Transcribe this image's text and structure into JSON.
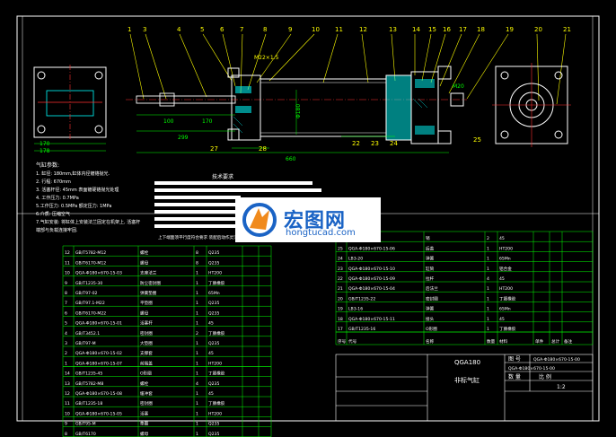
{
  "balloons": [
    "1",
    "3",
    "4",
    "5",
    "6",
    "7",
    "8",
    "9",
    "10",
    "11",
    "12",
    "13",
    "14",
    "15",
    "16",
    "17",
    "18",
    "19",
    "20",
    "21"
  ],
  "dims": {
    "d_m22": "M22×1.5",
    "d_100": "100",
    "d_170": "170",
    "d_299": "299",
    "d_660": "660",
    "d_27": "27",
    "d_28": "28",
    "d_22": "22",
    "d_23": "23",
    "d_24": "24",
    "d_25": "25",
    "d_26": "26",
    "d_m20": "M20",
    "d_180": "Φ180",
    "d_left1": "170",
    "d_left2": "178"
  },
  "notes": {
    "title": "气缸参数:",
    "lines": [
      "1. 缸径: 180mm,缸体内径镀铬抛光.",
      "2. 行程: 670mm",
      "3. 活塞杆径: 45mm  表面镀硬铬抛光处理",
      "4. 工作压力: 0.7MPa",
      "5.工作压力: 0.5MPa  额定压力: 1MPa",
      "6.介质: 压缩空气",
      "7.气缸安装: 将缸体上安装法兰固定在机架上, 活塞杆",
      "端部与负载连接牢固."
    ]
  },
  "tech": {
    "title": "技术要求",
    "bottom": "上下端面须平行度符合要求 装配后动作灵活,无卡滞和泄漏现象."
  },
  "watermark": {
    "cn": "宏图网",
    "url": "hongtucad.com"
  },
  "left_table": [
    [
      "12",
      "GB/T5782-M12",
      "螺栓",
      "8",
      "Q235",
      "",
      ""
    ],
    [
      "11",
      "GB/T6170-M12",
      "螺母",
      "8",
      "Q235",
      "",
      ""
    ],
    [
      "10",
      "QGA-Φ180×670-15-03",
      "支座法兰",
      "1",
      "HT200",
      "",
      ""
    ],
    [
      "9",
      "GB/T1235-30",
      "防尘密封圈",
      "1",
      "丁腈橡胶",
      "",
      ""
    ],
    [
      "8",
      "GB/T97-02",
      "弹簧垫圈",
      "1",
      "65Mn",
      "",
      ""
    ],
    [
      "7",
      "GB/T97.1-M22",
      "平垫圈",
      "1",
      "Q235",
      "",
      ""
    ],
    [
      "6",
      "GB/T6170-M22",
      "螺母",
      "1",
      "Q235",
      "",
      ""
    ],
    [
      "5",
      "QGA-Φ180×670-15-01",
      "活塞杆",
      "1",
      "45",
      "",
      ""
    ],
    [
      "4",
      "GB/T3452.1",
      "密封圈",
      "2",
      "丁腈橡胶",
      "",
      ""
    ],
    [
      "3",
      "GB/T97-M",
      "大垫圈",
      "1",
      "Q235",
      "",
      ""
    ],
    [
      "2",
      "QGA-Φ180×670-15-02",
      "支撑套",
      "1",
      "45",
      "",
      ""
    ],
    [
      "1",
      "QGA-Φ180×670-15-07",
      "前端盖",
      "1",
      "HT200",
      "",
      ""
    ]
  ],
  "left_table2": [
    [
      "14",
      "GB/T1235-45",
      "O形圈",
      "1",
      "丁腈橡胶",
      "",
      ""
    ],
    [
      "13",
      "GB/T5782-M8",
      "螺栓",
      "4",
      "Q235",
      "",
      ""
    ],
    [
      "12",
      "QGA-Φ180×670-15-08",
      "缓冲套",
      "1",
      "45",
      "",
      ""
    ],
    [
      "11",
      "GB/T1235-18",
      "密封圈",
      "1",
      "丁腈橡胶",
      "",
      ""
    ],
    [
      "10",
      "QGA-Φ180×670-15-05",
      "活塞",
      "1",
      "HT200",
      "",
      ""
    ],
    [
      "9",
      "GB/T95-M",
      "垫圈",
      "1",
      "Q235",
      "",
      ""
    ],
    [
      "8",
      "GB/T6170",
      "螺母",
      "1",
      "Q235",
      "",
      ""
    ]
  ],
  "right_table": [
    [
      "26",
      "GB/T119",
      "销",
      "2",
      "45",
      "",
      ""
    ],
    [
      "25",
      "QGA-Φ180×670-15-06",
      "后盖",
      "1",
      "HT200",
      "",
      ""
    ],
    [
      "24",
      "LB3-20",
      "弹簧",
      "1",
      "65Mn",
      "",
      ""
    ],
    [
      "23",
      "QGA-Φ180×670-15-10",
      "缸筒",
      "1",
      "铝合金",
      "",
      ""
    ],
    [
      "22",
      "QGA-Φ180×670-15-09",
      "拉杆",
      "4",
      "45",
      "",
      ""
    ],
    [
      "21",
      "QGA-Φ180×670-15-04",
      "后法兰",
      "1",
      "HT200",
      "",
      ""
    ],
    [
      "20",
      "GB/T1235-22",
      "密封圈",
      "1",
      "丁腈橡胶",
      "",
      ""
    ],
    [
      "19",
      "LB3-16",
      "弹簧",
      "1",
      "65Mn",
      "",
      ""
    ],
    [
      "18",
      "QGA-Φ180×670-15-11",
      "接头",
      "1",
      "45",
      "",
      ""
    ],
    [
      "17",
      "GB/T1235-16",
      "O形圈",
      "1",
      "丁腈橡胶",
      "",
      ""
    ]
  ],
  "header_row": [
    "序号",
    "代号",
    "名称",
    "数量",
    "材料",
    "单件",
    "总计",
    "备注"
  ],
  "title_block": {
    "name": "QGA180",
    "name2": "非标气缸",
    "code": "QGA-Φ180×670-15-00",
    "r1": "图 号",
    "r2": "数 量",
    "r3": "比 例",
    "scale": "1:2"
  }
}
